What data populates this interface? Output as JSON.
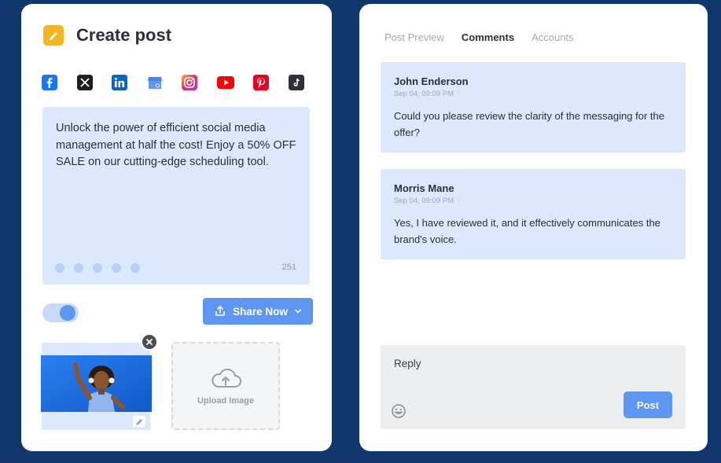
{
  "create_post": {
    "title": "Create post",
    "social_icons": [
      {
        "name": "facebook-icon",
        "color": "#1877f2",
        "glyph": "f"
      },
      {
        "name": "x-icon",
        "color": "#000000",
        "glyph": "𝕏"
      },
      {
        "name": "linkedin-icon",
        "color": "#0a66c2",
        "glyph": "in"
      },
      {
        "name": "google-business-icon",
        "color": "#4285f4",
        "glyph": "G"
      },
      {
        "name": "instagram-icon",
        "color": "#e1306c",
        "glyph": "◎"
      },
      {
        "name": "youtube-icon",
        "color": "#ff0000",
        "glyph": "▶"
      },
      {
        "name": "pinterest-icon",
        "color": "#e60023",
        "glyph": "P"
      },
      {
        "name": "tiktok-icon",
        "color": "#111111",
        "glyph": "♪"
      }
    ],
    "post_text": "Unlock the power of efficient social media management at half the cost!  Enjoy a 50% OFF SALE on our cutting-edge scheduling tool.",
    "char_count": "251",
    "share_button": "Share Now",
    "upload_label": "Upload Image"
  },
  "comments_panel": {
    "tabs": [
      {
        "label": "Post Preview",
        "active": false
      },
      {
        "label": "Comments",
        "active": true
      },
      {
        "label": "Accounts",
        "active": false
      }
    ],
    "comments": [
      {
        "author": "John Enderson",
        "time": "Sep 04, 09:09 PM",
        "body": "Could you please review the clarity of the messaging for the offer?"
      },
      {
        "author": "Morris Mane",
        "time": "Sep 04, 09:09 PM",
        "body": "Yes, I have reviewed it, and it effectively communicates the brand's voice."
      }
    ],
    "reply_placeholder": "Reply",
    "post_button": "Post"
  },
  "colors": {
    "background": "#0f376b",
    "accent": "#5e97f1",
    "card_tint": "#dbe8fd"
  }
}
